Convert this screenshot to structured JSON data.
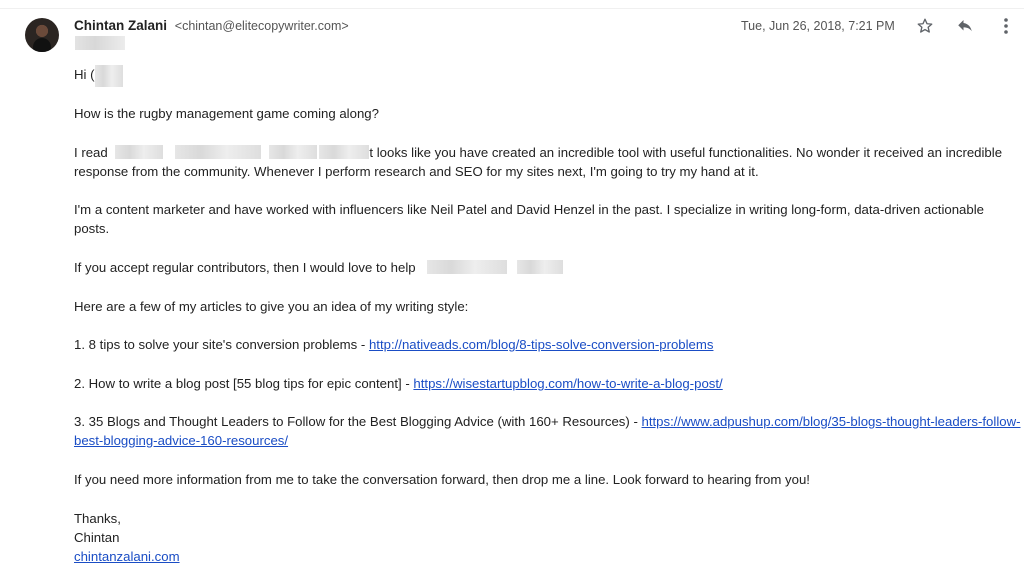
{
  "email": {
    "sender_name": "Chintan Zalani",
    "sender_email": "<chintan@elitecopywriter.com>",
    "date": "Tue, Jun 26, 2018, 7:21 PM"
  },
  "icons": {
    "star": "star-icon",
    "reply": "reply-icon",
    "more": "more-vert-icon"
  },
  "body": {
    "greeting": "Hi (",
    "p1": "How is the rugby management game coming along?",
    "p2_start": "I read",
    "p2_end": "t looks like you have created an incredible tool with useful functionalities. No wonder it received an incredible",
    "p2_line2": "response from the community. Whenever I perform research and SEO for my sites next, I'm going to try my hand at it.",
    "p3_line1": "I'm a content marketer and have worked with influencers like Neil Patel and David Henzel in the past. I specialize in writing long-form, data-driven actionable",
    "p3_line2": "posts.",
    "p4": "If you accept regular contributors, then I would love to help",
    "p5": "Here are a few of my articles to give you an idea of my writing style:",
    "article1_text": " 1. 8 tips to solve your site's conversion problems - ",
    "article1_link": "http://nativeads.com/blog/8-tips-solve-conversion-problems",
    "article2_text": "2. How to write a blog post [55 blog tips for epic content] - ",
    "article2_link": "https://wisestartupblog.com/how-to-write-a-blog-post/",
    "article3_text": "3. 35 Blogs and Thought Leaders to Follow for the Best Blogging Advice (with 160+ Resources) - ",
    "article3_link1": "https://www.adpushup.com/blog/35-blogs-thought-leaders-follow-",
    "article3_link2": "best-blogging-advice-160-resources/",
    "p6": "If you need more information from me to take the conversation forward, then drop me a line. Look forward to hearing from you!",
    "signoff": "Thanks,",
    "signature_name": "Chintan",
    "signature_link": "chintanzalani.com"
  }
}
